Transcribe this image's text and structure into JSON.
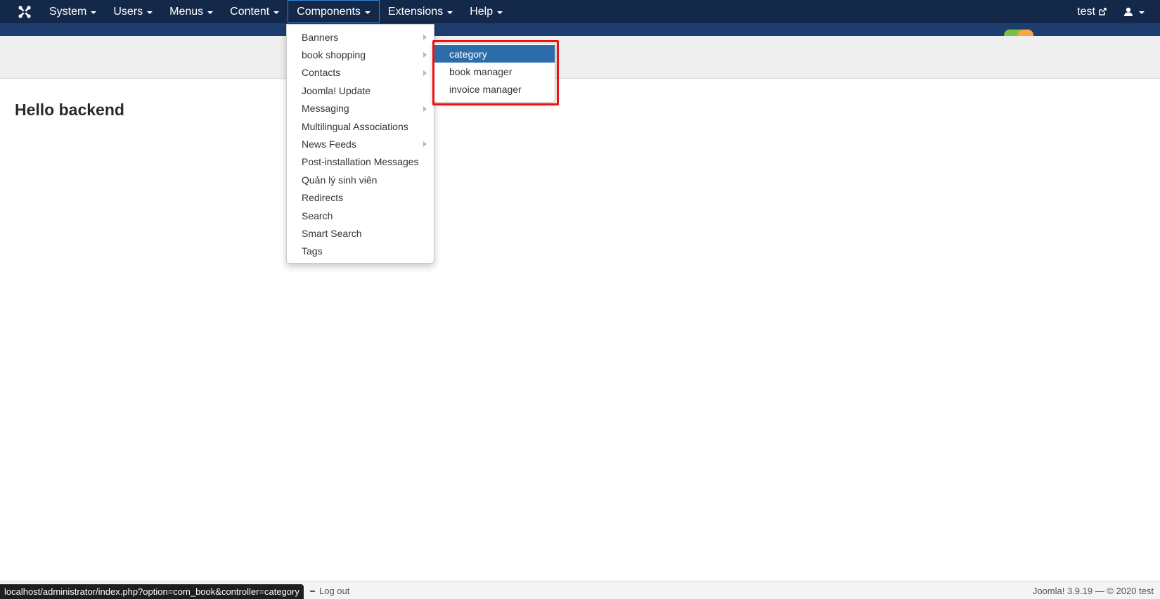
{
  "navbar": {
    "logo_icon": "joomla-icon",
    "menu": [
      {
        "label": "System"
      },
      {
        "label": "Users"
      },
      {
        "label": "Menus"
      },
      {
        "label": "Content"
      },
      {
        "label": "Components",
        "active": true
      },
      {
        "label": "Extensions"
      },
      {
        "label": "Help"
      }
    ],
    "user_link": "test",
    "user_link_icon": "external-link-icon",
    "user_menu_icon": "user-icon"
  },
  "main": {
    "heading": "Hello backend"
  },
  "components_dropdown": {
    "items": [
      {
        "label": "Banners",
        "has_submenu": true
      },
      {
        "label": "book shopping",
        "has_submenu": true
      },
      {
        "label": "Contacts",
        "has_submenu": true
      },
      {
        "label": "Joomla! Update",
        "has_submenu": false
      },
      {
        "label": "Messaging",
        "has_submenu": true
      },
      {
        "label": "Multilingual Associations",
        "has_submenu": false
      },
      {
        "label": "News Feeds",
        "has_submenu": true
      },
      {
        "label": "Post-installation Messages",
        "has_submenu": false
      },
      {
        "label": "Quản lý sinh viên",
        "has_submenu": false
      },
      {
        "label": "Redirects",
        "has_submenu": false
      },
      {
        "label": "Search",
        "has_submenu": false
      },
      {
        "label": "Smart Search",
        "has_submenu": false
      },
      {
        "label": "Tags",
        "has_submenu": false
      }
    ]
  },
  "book_shopping_submenu": {
    "items": [
      {
        "label": "category",
        "selected": true
      },
      {
        "label": "book manager",
        "selected": false
      },
      {
        "label": "invoice manager",
        "selected": false
      }
    ],
    "highlight_color": "#ef1111"
  },
  "footer": {
    "logout": "Log out",
    "version": "Joomla! 3.9.19  —  © 2020 test"
  },
  "status_bar": {
    "url": "localhost/administrator/index.php?option=com_book&controller=category"
  },
  "colors": {
    "navbar_bg": "#142849",
    "selected_bg": "#2c6da9"
  }
}
